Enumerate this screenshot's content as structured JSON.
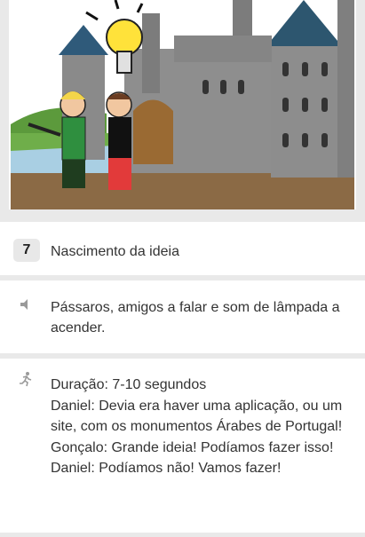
{
  "panel": {
    "number": "7",
    "title": "Nascimento da ideia"
  },
  "sound": {
    "icon": "speaker-icon",
    "text": "Pássaros, amigos a falar e som de lâmpada a acender."
  },
  "notes": {
    "icon": "running-person-icon",
    "lines": [
      "Duração: 7-10 segundos",
      "Daniel: Devia era haver uma aplicação, ou um site, com os monumentos Árabes de Portugal!",
      "Gonçalo: Grande ideia! Podíamos fazer isso!",
      "Daniel: Podíamos não! Vamos fazer!"
    ]
  },
  "colors": {
    "page_bg": "#e9e9e9",
    "card_bg": "#ffffff",
    "badge_bg": "#e8e8e8",
    "text": "#333333",
    "icon": "#9a9a9a"
  }
}
